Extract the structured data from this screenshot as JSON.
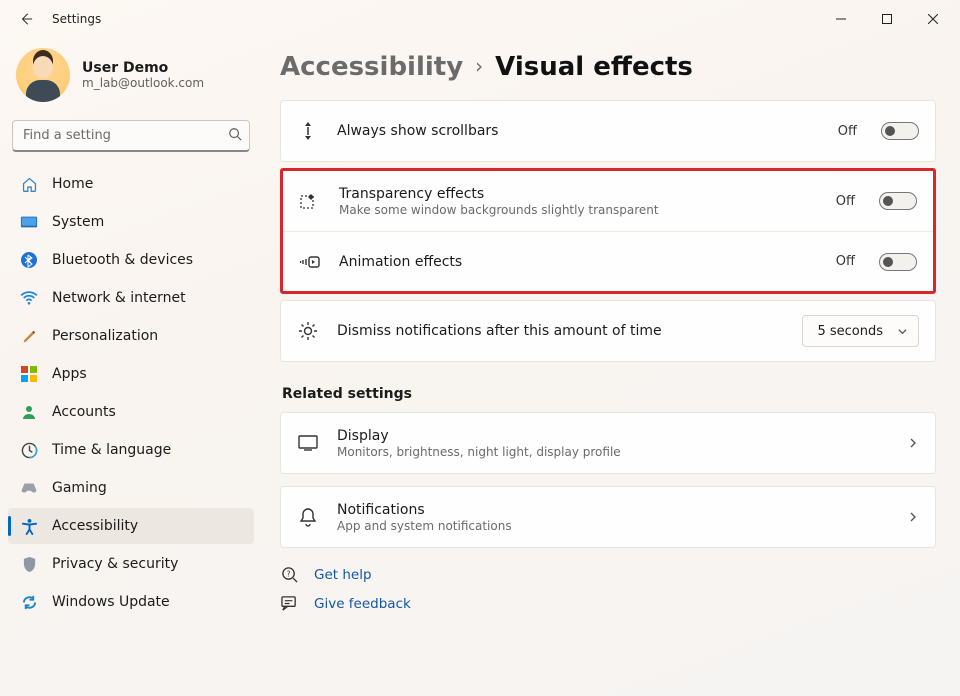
{
  "window": {
    "title": "Settings"
  },
  "user": {
    "name": "User Demo",
    "email": "m_lab@outlook.com"
  },
  "search": {
    "placeholder": "Find a setting"
  },
  "nav": {
    "items": [
      {
        "label": "Home"
      },
      {
        "label": "System"
      },
      {
        "label": "Bluetooth & devices"
      },
      {
        "label": "Network & internet"
      },
      {
        "label": "Personalization"
      },
      {
        "label": "Apps"
      },
      {
        "label": "Accounts"
      },
      {
        "label": "Time & language"
      },
      {
        "label": "Gaming"
      },
      {
        "label": "Accessibility"
      },
      {
        "label": "Privacy & security"
      },
      {
        "label": "Windows Update"
      }
    ]
  },
  "breadcrumb": {
    "parent": "Accessibility",
    "current": "Visual effects"
  },
  "settings": {
    "scrollbars": {
      "title": "Always show scrollbars",
      "state": "Off"
    },
    "transparency": {
      "title": "Transparency effects",
      "subtitle": "Make some window backgrounds slightly transparent",
      "state": "Off"
    },
    "animation": {
      "title": "Animation effects",
      "state": "Off"
    },
    "dismiss": {
      "title": "Dismiss notifications after this amount of time",
      "value": "5 seconds"
    }
  },
  "related": {
    "heading": "Related settings",
    "display": {
      "title": "Display",
      "subtitle": "Monitors, brightness, night light, display profile"
    },
    "notifications": {
      "title": "Notifications",
      "subtitle": "App and system notifications"
    }
  },
  "links": {
    "help": "Get help",
    "feedback": "Give feedback"
  }
}
